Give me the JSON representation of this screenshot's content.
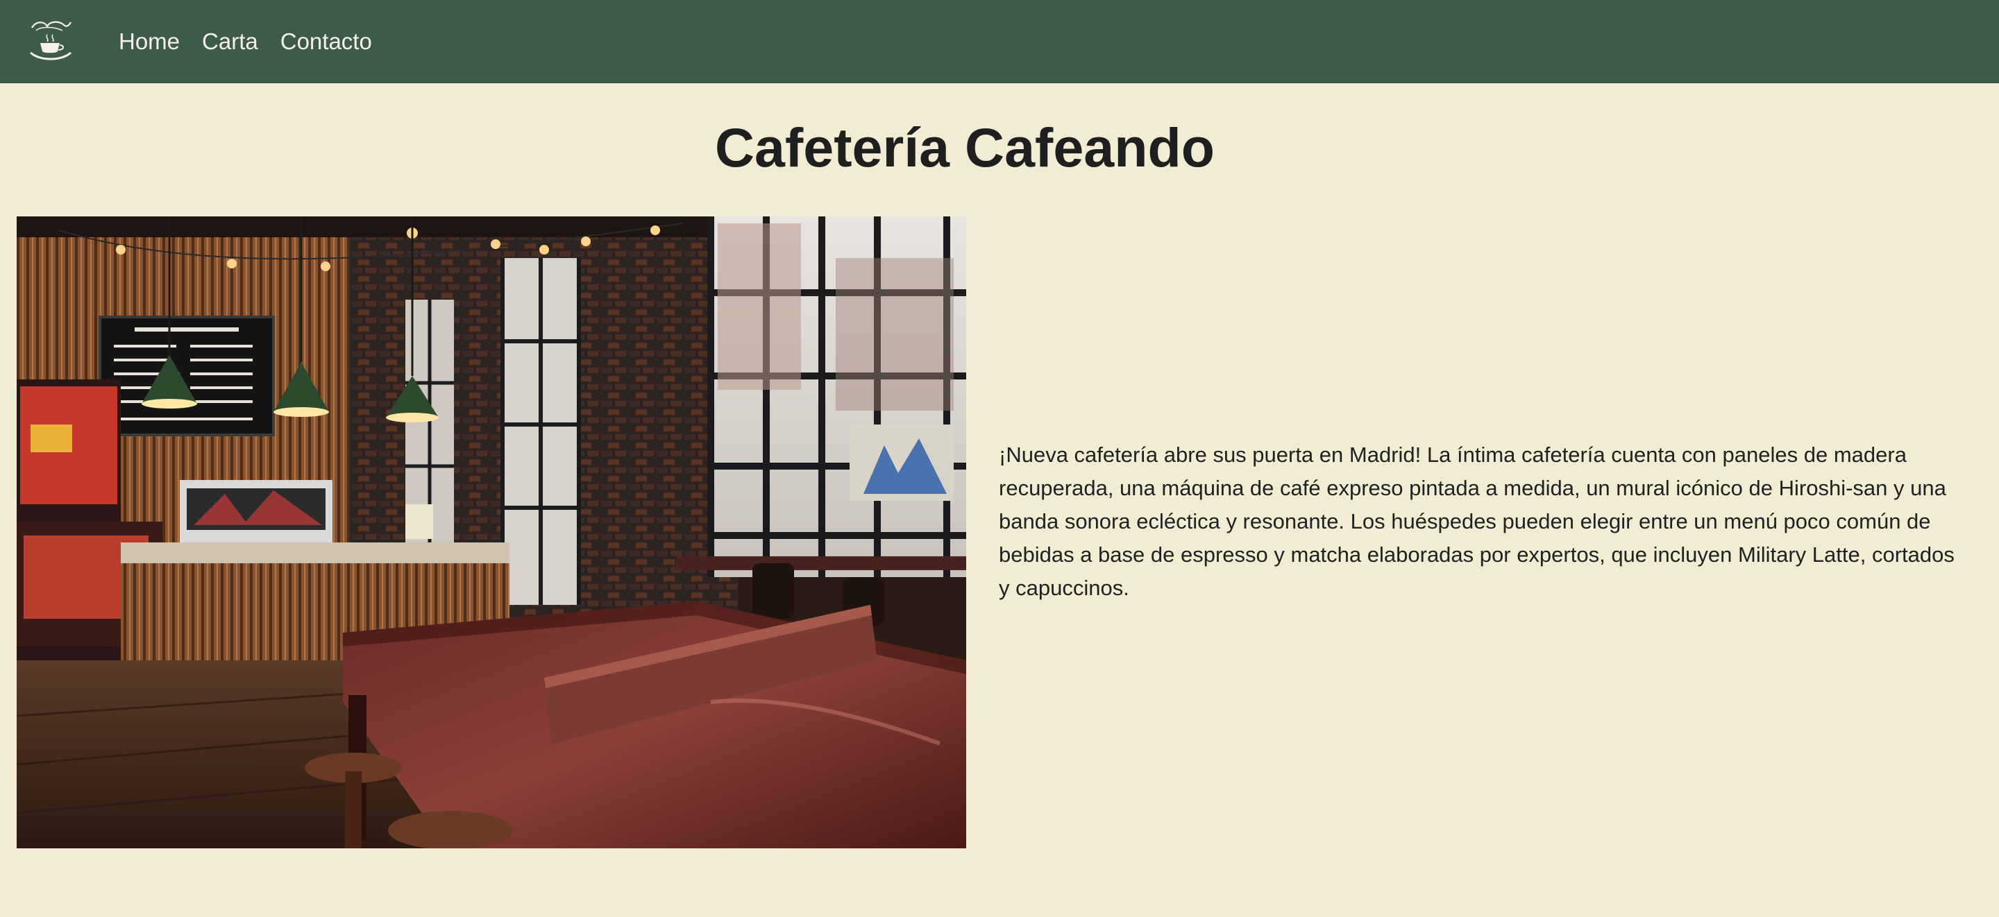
{
  "navbar": {
    "logo_icon": "cafe-cup-logo-icon",
    "links": [
      {
        "label": "Home"
      },
      {
        "label": "Carta"
      },
      {
        "label": "Contacto"
      }
    ],
    "background_color": "#3e5b49"
  },
  "main": {
    "title": "Cafetería Cafeando",
    "image_subject": "cafe-interior-photo",
    "description": "¡Nueva cafetería abre sus puerta en Madrid! La íntima cafetería cuenta con paneles de madera recuperada, una máquina de café expreso pintada a medida, un mural icónico de Hiroshi-san y una banda sonora ecléctica y resonante. Los huéspedes pueden elegir entre un menú poco común de bebidas a base de espresso y matcha elaboradas por expertos, que incluyen Military Latte, cortados y capuccinos."
  },
  "colors": {
    "page_background": "#f2ecd4",
    "nav_text": "#f4f1e6"
  }
}
